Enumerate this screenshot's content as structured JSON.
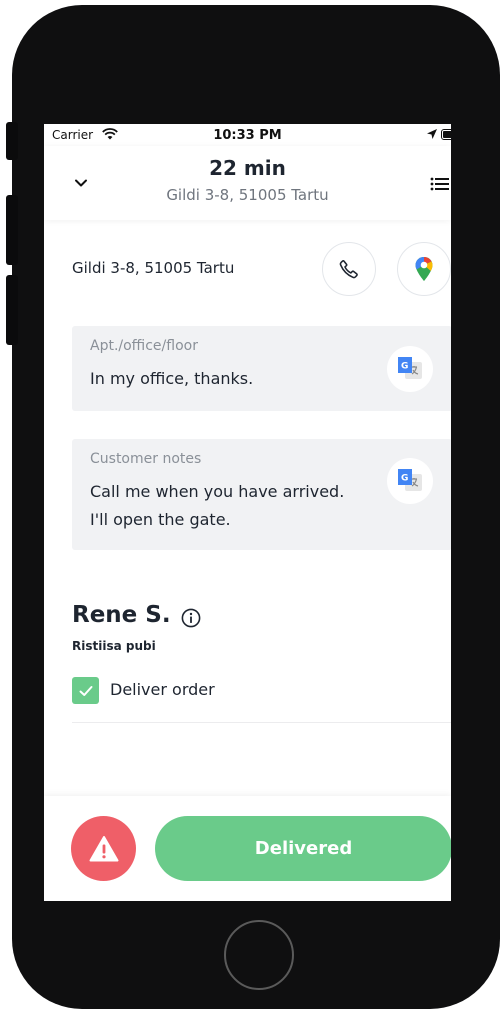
{
  "status_bar": {
    "carrier": "Carrier",
    "time": "10:33 PM"
  },
  "header": {
    "eta": "22 min",
    "address": "Gildi 3-8, 51005 Tartu"
  },
  "address_row": {
    "address": "Gildi 3-8, 51005 Tartu"
  },
  "apartment_note": {
    "label": "Apt./office/floor",
    "text": "In my office, thanks."
  },
  "customer_note": {
    "label": "Customer notes",
    "line1": "Call me when you have arrived.",
    "line2": "I'll open the gate."
  },
  "customer": {
    "name": "Rene S.",
    "venue": "Ristiisa pubi"
  },
  "tasks": {
    "deliver_order": "Deliver order",
    "deliver_order_checked": true
  },
  "actions": {
    "delivered_label": "Delivered"
  },
  "colors": {
    "green": "#6acb8a",
    "red": "#ef5f68",
    "card_bg": "#f1f2f4",
    "text": "#1e2530"
  }
}
